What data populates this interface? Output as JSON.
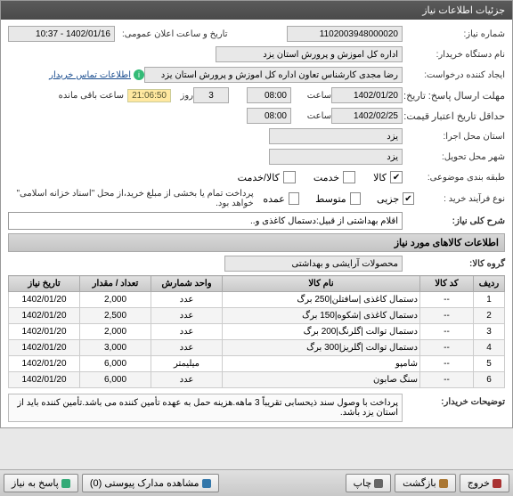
{
  "titlebar": "جزئیات اطلاعات نیاز",
  "labels": {
    "reqNumber": "شماره نیاز:",
    "announceDate": "تاریخ و ساعت اعلان عمومی:",
    "buyerOrg": "نام دستگاه خریدار:",
    "requester": "ایجاد کننده درخواست:",
    "contactInfo": "اطلاعات تماس خریدار",
    "replyDeadline": "مهلت ارسال پاسخ:",
    "replyToDate": "تاریخ: تا تاریخ:",
    "hour": "ساعت",
    "day": "روز",
    "remaining": "ساعت باقی مانده",
    "creditMin": "حداقل تاریخ اعتبار",
    "creditTo": "قیمت: تا تاریخ:",
    "execProvince": "استان محل اجرا:",
    "deliveryCity": "شهر محل تحویل:",
    "subjectClass": "طبقه بندی موضوعی:",
    "purchaseType": "نوع فرآیند خرید :",
    "generalDesc": "شرح کلی نیاز:",
    "itemsHeader": "اطلاعات کالاهای مورد نیاز",
    "goodsGroup": "گروه کالا:",
    "buyerNotes": "توضیحات خریدار:"
  },
  "values": {
    "reqNumber": "1102003948000020",
    "announceDate": "1402/01/16 - 10:37",
    "buyerOrg": "اداره کل اموزش و پرورش استان یزد",
    "requester": "رضا مجدی کارشناس تعاون اداره کل اموزش و پرورش استان یزد",
    "replyDate": "1402/01/20",
    "replyHour": "08:00",
    "days": "3",
    "countdown": "21:06:50",
    "creditDate": "1402/02/25",
    "creditHour": "08:00",
    "execProvince": "یزد",
    "deliveryCity": "یزد",
    "purchaseNote": "پرداخت تمام یا بخشی از مبلغ خرید،از محل \"اسناد خزانه اسلامی\" خواهد بود.",
    "generalDesc": "اقلام بهداشتی از قبیل:دستمال کاغذی و..",
    "goodsGroup": "محصولات آرایشی و بهداشتی",
    "buyerNotes": "پرداخت با وصول سند ذیحسابی تقریباً 3 ماهه.هزینه حمل به عهده تأمین کننده می باشد.تأمین کننده باید از استان یزد باشد."
  },
  "classifyOptions": {
    "goods": "کالا",
    "service": "خدمت",
    "goodsService": "کالا/خدمت"
  },
  "purchaseOptions": {
    "low": "جزیی",
    "mid": "متوسط",
    "high": "عمده"
  },
  "table": {
    "headers": [
      "ردیف",
      "کد کالا",
      "نام کالا",
      "واحد شمارش",
      "تعداد / مقدار",
      "تاریخ نیاز"
    ],
    "rows": [
      [
        "1",
        "--",
        "دستمال کاغذی |سافتلن|250 برگ",
        "عدد",
        "2,000",
        "1402/01/20"
      ],
      [
        "2",
        "--",
        "دستمال کاغذی |شکوه|150 برگ",
        "عدد",
        "2,500",
        "1402/01/20"
      ],
      [
        "3",
        "--",
        "دستمال توالت |گلرنگ|200 برگ",
        "عدد",
        "2,000",
        "1402/01/20"
      ],
      [
        "4",
        "--",
        "دستمال توالت |گلریز|300 برگ",
        "عدد",
        "3,000",
        "1402/01/20"
      ],
      [
        "5",
        "--",
        "شامپو",
        "میلیمتر",
        "6,000",
        "1402/01/20"
      ],
      [
        "6",
        "--",
        "سنگ صابون",
        "عدد",
        "6,000",
        "1402/01/20"
      ]
    ]
  },
  "footer": {
    "reply": "پاسخ به نیاز",
    "viewAttach": "مشاهده مدارک پیوستی (0)",
    "print": "چاپ",
    "back": "بازگشت",
    "exit": "خروج"
  }
}
